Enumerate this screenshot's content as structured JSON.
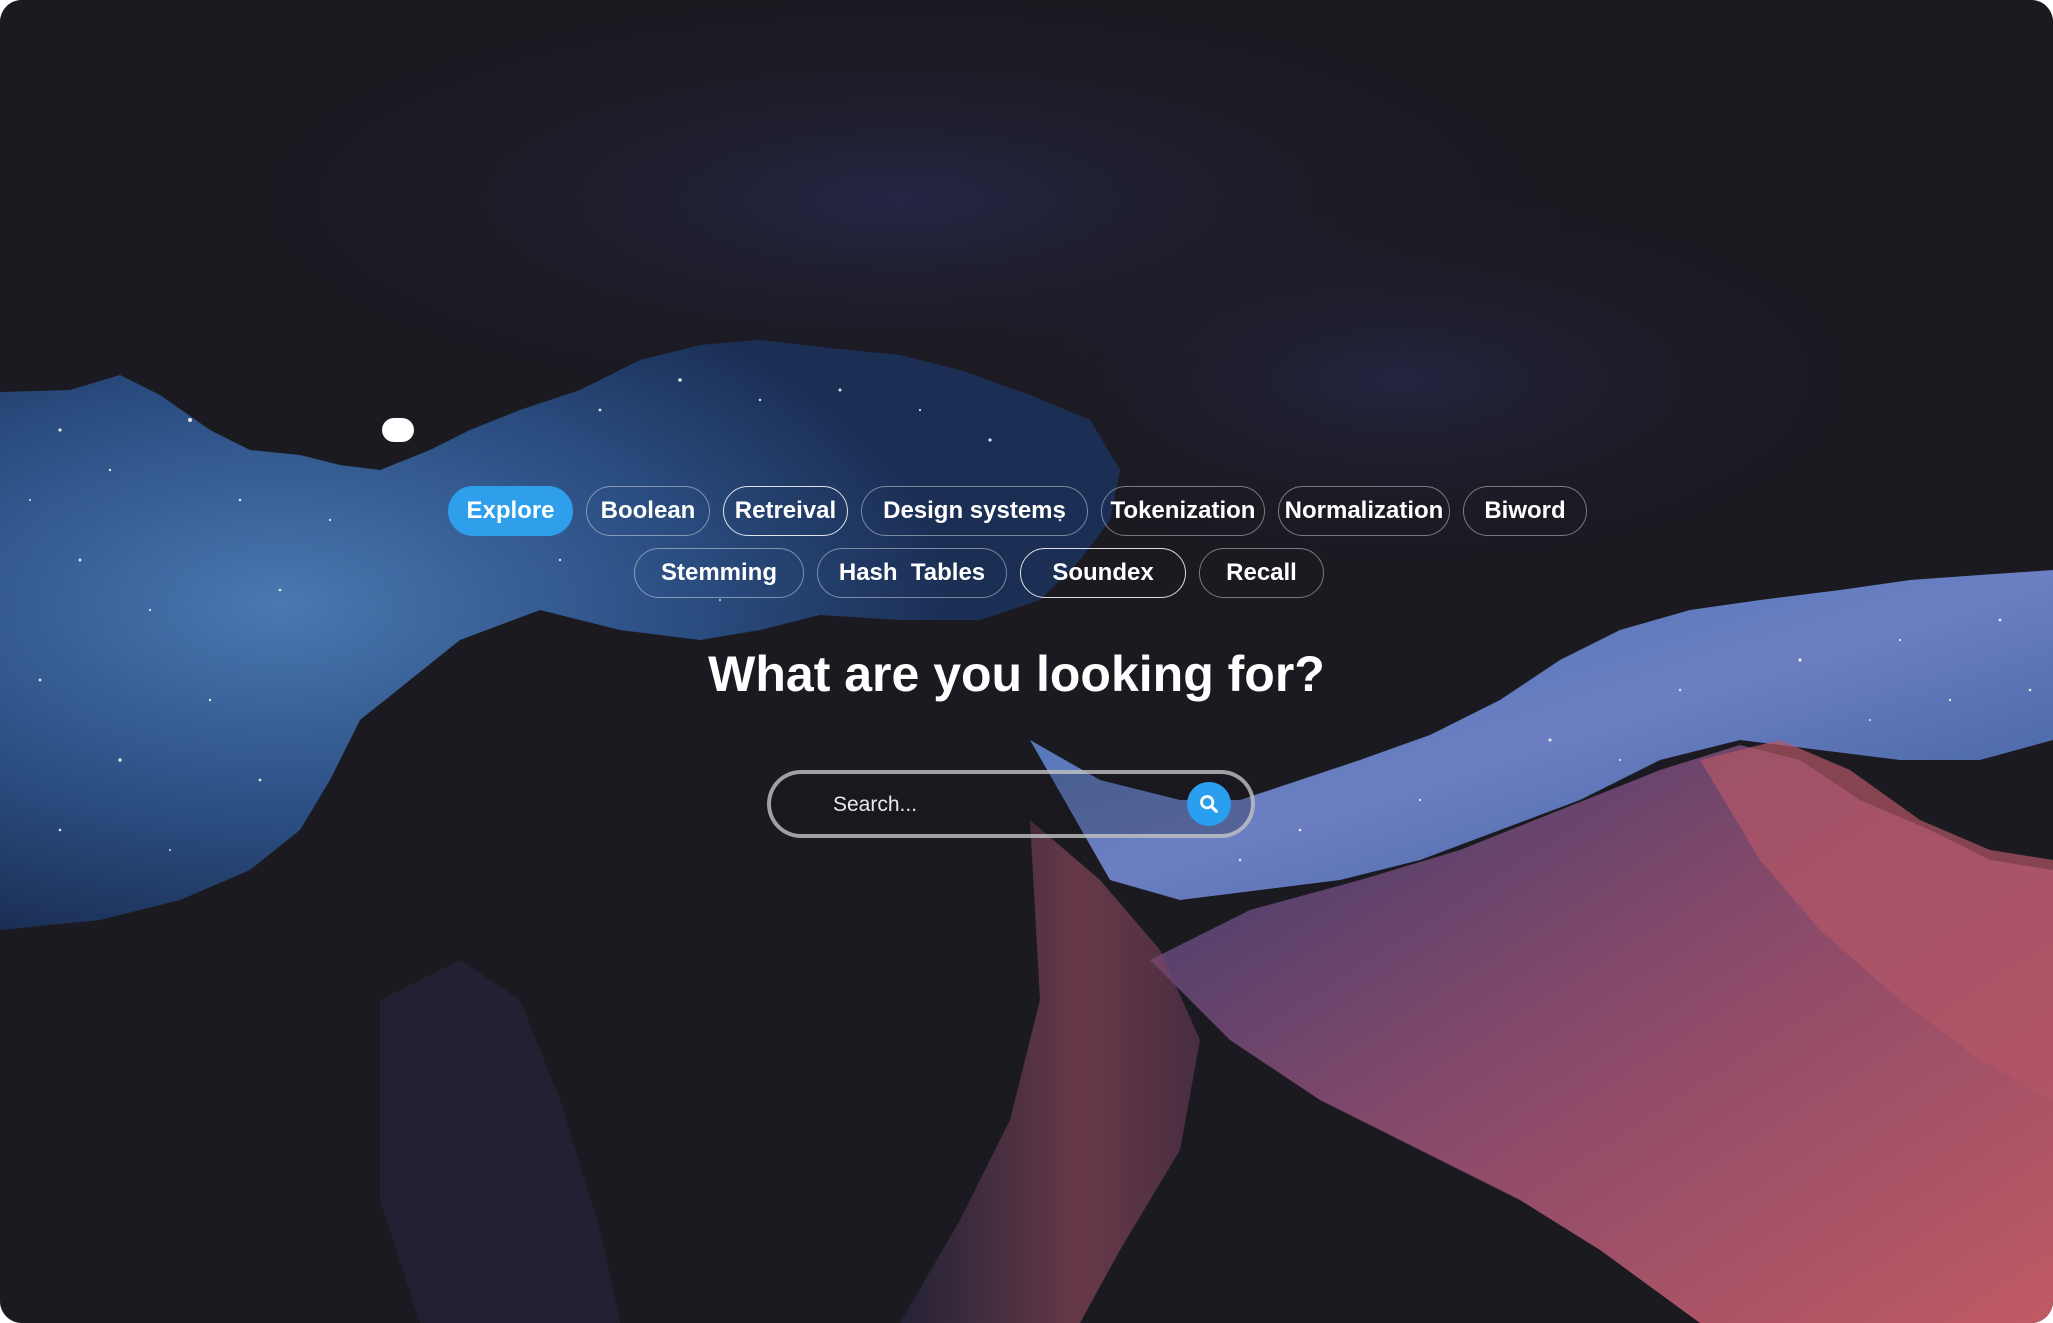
{
  "colors": {
    "accent": "#2f9fec",
    "background": "#1b1a21",
    "text": "#ffffff"
  },
  "topics": {
    "row1": [
      "Explore",
      "Boolean",
      "Retreival",
      "Design systems",
      "Tokenization",
      "Normalization",
      "Biword"
    ],
    "row2": [
      "Stemming",
      "Hash  Tables",
      "Soundex",
      "Recall"
    ],
    "active": "Explore"
  },
  "hero": {
    "title": "What are you looking for?"
  },
  "search": {
    "placeholder": "Search...",
    "value": "",
    "icon": "search-icon"
  }
}
